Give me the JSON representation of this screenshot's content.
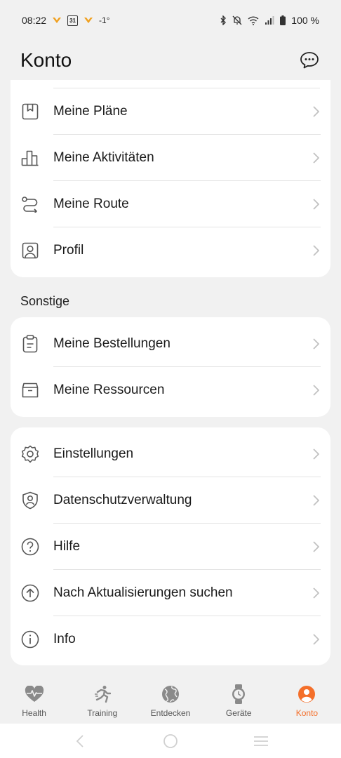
{
  "status_bar": {
    "time": "08:22",
    "calendar_day": "31",
    "temperature": "-1°",
    "battery": "100 %"
  },
  "header": {
    "title": "Konto",
    "chat_icon": "chat-bubble-icon"
  },
  "account_section": {
    "items": [
      {
        "label": "Meine Pläne",
        "icon": "bookmark-icon"
      },
      {
        "label": "Meine Aktivitäten",
        "icon": "activity-bars-icon"
      },
      {
        "label": "Meine Route",
        "icon": "route-icon"
      },
      {
        "label": "Profil",
        "icon": "profile-icon"
      }
    ]
  },
  "other_section": {
    "title": "Sonstige",
    "items": [
      {
        "label": "Meine Bestellungen",
        "icon": "clipboard-icon"
      },
      {
        "label": "Meine Ressourcen",
        "icon": "archive-box-icon"
      }
    ]
  },
  "settings_section": {
    "items": [
      {
        "label": "Einstellungen",
        "icon": "gear-icon"
      },
      {
        "label": "Datenschutzverwaltung",
        "icon": "privacy-shield-icon"
      },
      {
        "label": "Hilfe",
        "icon": "help-icon"
      },
      {
        "label": "Nach Aktualisierungen suchen",
        "icon": "update-arrow-icon"
      },
      {
        "label": "Info",
        "icon": "info-icon"
      }
    ]
  },
  "bottom_nav": {
    "items": [
      {
        "label": "Health",
        "icon": "heart-pulse-icon",
        "active": false
      },
      {
        "label": "Training",
        "icon": "running-icon",
        "active": false
      },
      {
        "label": "Entdecken",
        "icon": "globe-icon",
        "active": false
      },
      {
        "label": "Geräte",
        "icon": "watch-icon",
        "active": false
      },
      {
        "label": "Konto",
        "icon": "person-icon",
        "active": true
      }
    ]
  },
  "colors": {
    "accent": "#f46f2a",
    "background": "#f1f1f1",
    "card": "#ffffff",
    "icon": "#555555",
    "chevron": "#c2c2c2"
  }
}
